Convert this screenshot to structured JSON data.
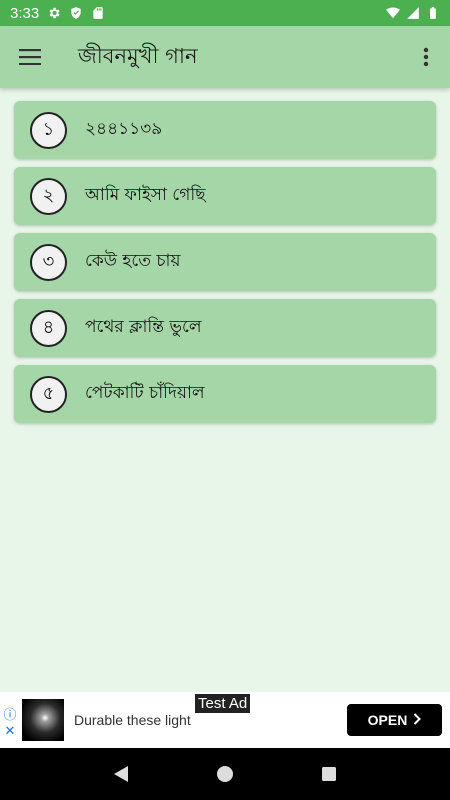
{
  "status_bar": {
    "time": "3:33",
    "left_icons": [
      "settings-icon",
      "shield-icon",
      "sd-card-icon"
    ],
    "right_icons": [
      "wifi-icon",
      "signal-icon",
      "battery-icon"
    ]
  },
  "app_bar": {
    "title": "জীবনমুখী গান",
    "menu_icon": "hamburger-menu-icon",
    "overflow_icon": "more-vert-icon"
  },
  "songs": [
    {
      "number": "১",
      "title": "২৪৪১১৩৯"
    },
    {
      "number": "২",
      "title": "আমি ফাইসা গেছি"
    },
    {
      "number": "৩",
      "title": "কেউ হতে চায়"
    },
    {
      "number": "৪",
      "title": "পথের ক্লান্তি ভুলে"
    },
    {
      "number": "৫",
      "title": "পেটকাটি চাঁদিয়াল"
    }
  ],
  "ad": {
    "label": "Test Ad",
    "text": "Durable these light",
    "button": "OPEN",
    "info_glyph": "ⓘ",
    "close_glyph": "✕"
  },
  "colors": {
    "status_bar": "#4caf50",
    "app_bar": "#a5d6a7",
    "card": "#a5d6a7",
    "background": "#e8f5e9"
  }
}
